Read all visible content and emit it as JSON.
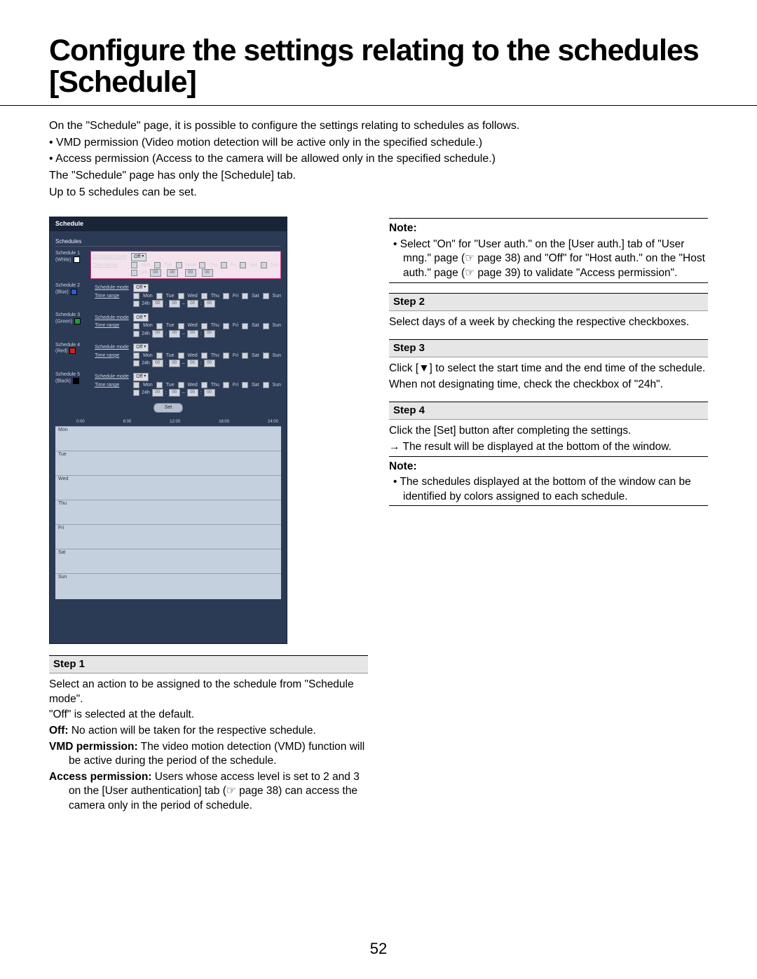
{
  "page_number": "52",
  "title": "Configure the settings relating to the schedules [Schedule]",
  "intro": {
    "l1": "On the \"Schedule\" page, it is possible to configure the settings relating to schedules as follows.",
    "l2": "• VMD permission (Video motion detection will be active only in the specified schedule.)",
    "l3": "• Access permission (Access to the camera will be allowed only in the specified schedule.)",
    "l4": "The \"Schedule\" page has only the [Schedule] tab.",
    "l5": "Up to 5 schedules can be set."
  },
  "screenshot": {
    "tab": "Schedule",
    "section": "Schedules",
    "mode_label": "Schedule mode",
    "range_label": "Time range",
    "mode_value": "Off",
    "days": [
      "Mon",
      "Tue",
      "Wed",
      "Thu",
      "Fri",
      "Sat",
      "Sun"
    ],
    "h24": "24h",
    "time_vals": [
      "00",
      "00",
      "00",
      "00"
    ],
    "sep": "–",
    "set": "Set",
    "schedules": [
      {
        "label": "Schedule 1",
        "sub": "(White)",
        "color": "#ffffff",
        "hl": true
      },
      {
        "label": "Schedule 2",
        "sub": "(Blue)",
        "color": "#2b5bd6",
        "hl": false
      },
      {
        "label": "Schedule 3",
        "sub": "(Green)",
        "color": "#1e9e3a",
        "hl": false
      },
      {
        "label": "Schedule 4",
        "sub": "(Red)",
        "color": "#d02222",
        "hl": false
      },
      {
        "label": "Schedule 5",
        "sub": "(Black)",
        "color": "#000000",
        "hl": false
      }
    ],
    "timeline_ticks": [
      "0:00",
      "6:00",
      "12:00",
      "18:00",
      "24:00"
    ],
    "timeline_days": [
      "Mon",
      "Tue",
      "Wed",
      "Thu",
      "Fri",
      "Sat",
      "Sun"
    ]
  },
  "left": {
    "step1": "Step 1",
    "p1": "Select an action to be assigned to the schedule from \"Schedule mode\".",
    "p2": "\"Off\" is selected at the default.",
    "off_b": "Off:",
    "off_t": " No action will be taken for the respective schedule.",
    "vmd_b": "VMD permission:",
    "vmd_t": " The video motion detection (VMD) function will be active during the period of the schedule.",
    "acc_b": "Access permission:",
    "acc_t": " Users whose access level is set to 2 and 3 on the [User authentication] tab (☞ page 38) can access the camera only in the period of schedule."
  },
  "right": {
    "note1_h": "Note:",
    "note1_t": "• Select \"On\" for \"User auth.\" on the [User auth.] tab of \"User mng.\" page (☞ page 38) and \"Off\" for \"Host auth.\" on the \"Host auth.\" page (☞ page 39) to validate \"Access permission\".",
    "step2": "Step 2",
    "step2_t": "Select days of a week by checking the respective checkboxes.",
    "step3": "Step 3",
    "step3_t1": "Click [▼] to select the start time and the end time of the schedule.",
    "step3_t2": "When not designating time, check the checkbox of \"24h\".",
    "step4": "Step 4",
    "step4_t1": "Click the [Set] button after completing the settings.",
    "step4_t2": "→ The result will be displayed at the bottom of the window.",
    "note2_h": "Note:",
    "note2_t": "• The schedules displayed at the bottom of the window can be identified by colors assigned to each schedule."
  }
}
